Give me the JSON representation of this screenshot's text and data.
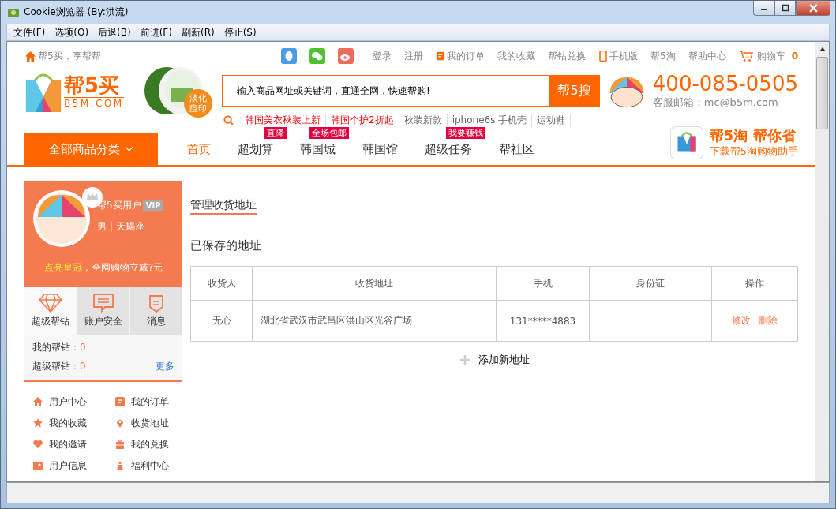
{
  "window": {
    "title": "Cookie浏览器 (By:洪流)"
  },
  "menu": [
    "文件(F)",
    "选项(O)",
    "后退(B)",
    "前进(F)",
    "刷新(R)",
    "停止(S)"
  ],
  "top_bar": {
    "slogan": "帮5买，享帮帮",
    "links": [
      {
        "label": "登录",
        "kind": "plain"
      },
      {
        "label": "注册",
        "kind": "plain"
      },
      {
        "label": "我的订单",
        "kind": "order"
      },
      {
        "label": "我的收藏",
        "kind": "plain"
      },
      {
        "label": "帮钻兑换",
        "kind": "plain"
      },
      {
        "label": "手机版",
        "kind": "phone"
      },
      {
        "label": "帮5淘",
        "kind": "plain"
      },
      {
        "label": "帮助中心",
        "kind": "plain"
      }
    ],
    "cart": {
      "label": "购物车",
      "count": "0"
    }
  },
  "logo": {
    "name": "帮5买",
    "domain": "B5M.COM"
  },
  "promo_badge": [
    "淡化",
    "痘印"
  ],
  "search": {
    "placeholder": "输入商品网址或关键词，直通全网，快速帮购!",
    "button": "帮5搜"
  },
  "hot_words": [
    {
      "label": "韩国美衣秋装上新",
      "hot": true
    },
    {
      "label": "韩国个护2折起",
      "hot": true
    },
    {
      "label": "秋装新款",
      "hot": false
    },
    {
      "label": "iphone6s 手机壳",
      "hot": false
    },
    {
      "label": "运动鞋",
      "hot": false
    }
  ],
  "hotline": {
    "phone": "400-085-0505",
    "email": "客服邮箱：mc@b5m.com"
  },
  "nav": {
    "category_button": "全部商品分类",
    "items": [
      {
        "label": "首页",
        "selected": true
      },
      {
        "label": "超划算",
        "selected": false,
        "badge": "直降"
      },
      {
        "label": "韩国城",
        "selected": false,
        "badge": "全场包邮"
      },
      {
        "label": "韩国馆",
        "selected": false
      },
      {
        "label": "超级任务",
        "selected": false,
        "badge": "我要赚钱"
      },
      {
        "label": "帮社区",
        "selected": false
      }
    ]
  },
  "app_promo": {
    "title": "帮5淘 帮你省",
    "subtitle": "下载帮5淘购物助手"
  },
  "profile": {
    "username": "帮5买用户",
    "vip": "VIP",
    "info": "男 | 天蝎座",
    "crown_tip": "点亮皇冠",
    "crown_rest": "，全网购物立减?元"
  },
  "quick_tabs": [
    {
      "label": "超级帮钻",
      "kind": "diamond",
      "selected": true
    },
    {
      "label": "账户安全",
      "kind": "message",
      "selected": false
    },
    {
      "label": "消息",
      "kind": "shield",
      "selected": false
    }
  ],
  "stats": [
    {
      "label": "我的帮钻：",
      "value": "0"
    },
    {
      "label": "超级帮钻：",
      "value": "0"
    }
  ],
  "stats_more": "更多",
  "side_menu": [
    {
      "label": "用户中心",
      "kind": "home"
    },
    {
      "label": "我的订单",
      "kind": "order"
    },
    {
      "label": "我的收藏",
      "kind": "star"
    },
    {
      "label": "收货地址",
      "kind": "pin"
    },
    {
      "label": "我的邀请",
      "kind": "heart"
    },
    {
      "label": "我的兑换",
      "kind": "gift"
    },
    {
      "label": "用户信息",
      "kind": "card"
    },
    {
      "label": "福利中心",
      "kind": "bag"
    }
  ],
  "main": {
    "title": "管理收货地址",
    "subtitle": "已保存的地址",
    "table": {
      "columns": [
        "收货人",
        "收货地址",
        "手机",
        "身份证",
        "操作"
      ],
      "rows": [
        {
          "name": "无心",
          "address": "湖北省武汉市武昌区洪山区光谷广场",
          "phone": "131*****4883",
          "actions": [
            "修改",
            "删除"
          ]
        }
      ]
    },
    "add_button": "添加新地址"
  }
}
